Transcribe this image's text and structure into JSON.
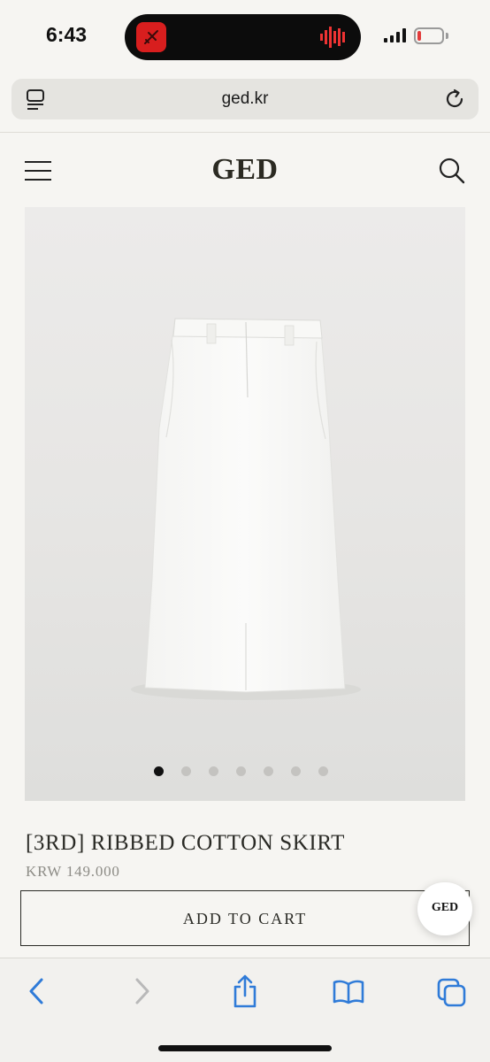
{
  "status_bar": {
    "time": "6:43",
    "battery_level": 0.15,
    "battery_color": "#e23b3b",
    "island_app_color": "#d81e1e"
  },
  "browser": {
    "url": "ged.kr",
    "icons": [
      "reader-icon",
      "reload-icon"
    ]
  },
  "site_header": {
    "logo": "GED",
    "icons": [
      "menu-icon",
      "search-icon"
    ]
  },
  "product": {
    "image_alt_subject": "white cotton midi skirt",
    "carousel": {
      "total": 7,
      "active_index": 0
    },
    "name": "[3RD] RIBBED COTTON SKIRT",
    "price": "KRW 149.000",
    "add_to_cart_label": "ADD TO CART"
  },
  "chat_badge": {
    "label": "GED"
  },
  "toolbar": {
    "items": [
      "back-icon",
      "forward-icon",
      "share-icon",
      "bookmarks-icon",
      "tabs-icon"
    ],
    "accent_color": "#2f7bd8"
  }
}
